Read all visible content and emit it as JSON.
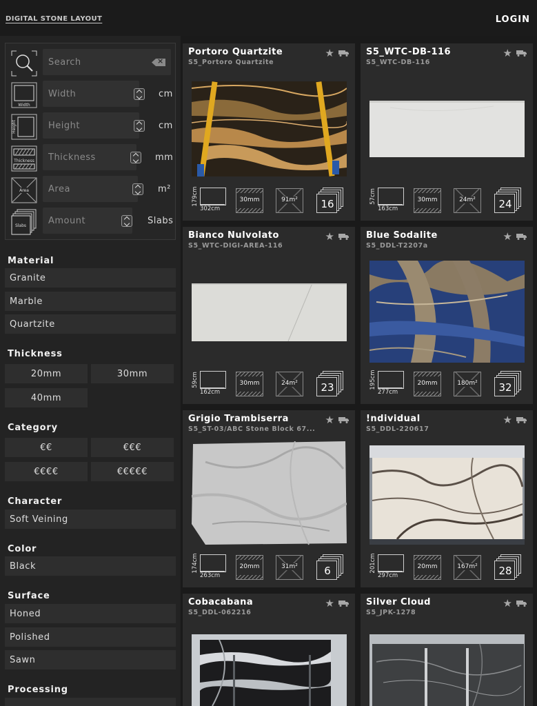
{
  "header": {
    "brand": "DIGITAL STONE LAYOUT",
    "login": "LOGIN"
  },
  "filters": {
    "search": {
      "placeholder": "Search"
    },
    "width": {
      "placeholder": "Width",
      "unit": "cm",
      "icon_label": "Width"
    },
    "height": {
      "placeholder": "Height",
      "unit": "cm",
      "icon_label": "Height"
    },
    "thickness": {
      "placeholder": "Thickness",
      "unit": "mm",
      "icon_label": "Thickness"
    },
    "area": {
      "placeholder": "Area",
      "unit": "m²",
      "icon_label": "Area"
    },
    "amount": {
      "placeholder": "Amount",
      "unit": "Slabs",
      "icon_label": "Slabs"
    }
  },
  "sections": {
    "material": {
      "title": "Material",
      "options": [
        "Granite",
        "Marble",
        "Quartzite"
      ]
    },
    "thickness": {
      "title": "Thickness",
      "options": [
        "20mm",
        "30mm",
        "40mm"
      ]
    },
    "category": {
      "title": "Category",
      "options": [
        "€€",
        "€€€",
        "€€€€",
        "€€€€€"
      ]
    },
    "character": {
      "title": "Character",
      "options": [
        "Soft Veining"
      ]
    },
    "color": {
      "title": "Color",
      "options": [
        "Black"
      ]
    },
    "surface": {
      "title": "Surface",
      "options": [
        "Honed",
        "Polished",
        "Sawn"
      ]
    },
    "processing": {
      "title": "Processing"
    }
  },
  "cards": [
    {
      "title": "Portoro Quartzite",
      "subtitle": "S5_Portoro Quartzite",
      "height": "179cm",
      "width": "302cm",
      "thickness": "30mm",
      "area": "91m²",
      "slabs": "16"
    },
    {
      "title": "S5_WTC-DB-116",
      "subtitle": "S5_WTC-DB-116",
      "height": "57cm",
      "width": "163cm",
      "thickness": "30mm",
      "area": "24m²",
      "slabs": "24"
    },
    {
      "title": "Bianco Nulvolato",
      "subtitle": "S5_WTC-DIGI-AREA-116",
      "height": "59cm",
      "width": "162cm",
      "thickness": "30mm",
      "area": "24m²",
      "slabs": "23"
    },
    {
      "title": "Blue Sodalite",
      "subtitle": "S5_DDL-T2207a",
      "height": "195cm",
      "width": "277cm",
      "thickness": "20mm",
      "area": "180m²",
      "slabs": "32"
    },
    {
      "title": "Grigio Trambiserra",
      "subtitle": "S5_ST-03/ABC Stone Block 67...",
      "height": "174cm",
      "width": "263cm",
      "thickness": "20mm",
      "area": "31m²",
      "slabs": "6"
    },
    {
      "title": "!ndividual",
      "subtitle": "S5_DDL-220617",
      "height": "201cm",
      "width": "297cm",
      "thickness": "20mm",
      "area": "167m²",
      "slabs": "28"
    },
    {
      "title": "Cobacabana",
      "subtitle": "S5_DDL-062216"
    },
    {
      "title": "Silver Cloud",
      "subtitle": "S5_JPK-1278"
    }
  ]
}
